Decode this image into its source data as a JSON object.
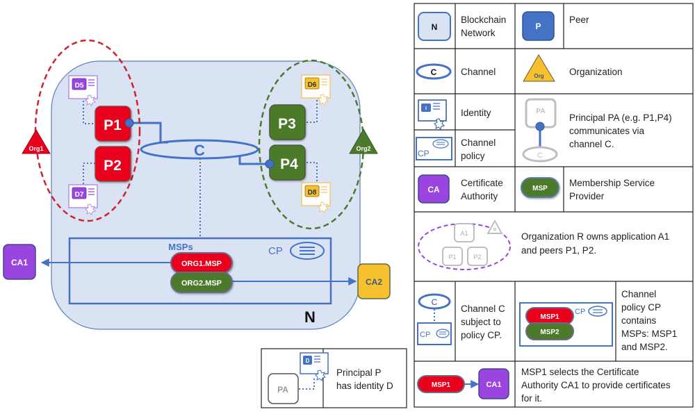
{
  "colors": {
    "network_fill": "#dae3f3",
    "network_stroke": "#2f5597",
    "blue": "#4472c4",
    "red": "#e8001c",
    "green": "#4b7a2c",
    "purple": "#9b45e0",
    "yellow": "#f6c02f",
    "gray": "#a6a6a6"
  },
  "diagram": {
    "network_label": "N",
    "channel_label": "C",
    "org1_label": "Org1",
    "org2_label": "Org2",
    "peers": [
      "P1",
      "P2",
      "P3",
      "P4"
    ],
    "identities": [
      "D5",
      "D6",
      "D7",
      "D8"
    ],
    "msps_title": "MSPs",
    "cp_label": "CP",
    "msp_items": [
      "ORG1.MSP",
      "ORG2.MSP"
    ],
    "ca1": "CA1",
    "ca2": "CA2"
  },
  "identity_legend": {
    "pa_label": "PA",
    "d_label": "D",
    "text_lines": [
      "Principal P",
      "has identity D"
    ]
  },
  "legend": {
    "network": {
      "icon": "N",
      "lines": [
        "Blockchain",
        "Network"
      ]
    },
    "peer": {
      "icon": "P",
      "lines": [
        "Peer"
      ]
    },
    "channel": {
      "icon": "C",
      "lines": [
        "Channel"
      ]
    },
    "organization": {
      "icon": "Org",
      "lines": [
        "Organization"
      ]
    },
    "identity": {
      "icon": "I",
      "lines": [
        "Identity"
      ]
    },
    "channel_policy": {
      "icon": "CP",
      "lines": [
        "Channel",
        "policy"
      ]
    },
    "principal": {
      "icon_pa": "PA",
      "icon_c": "C",
      "lines": [
        "Principal PA (e.g. P1,P4)",
        "communicates via",
        "channel C."
      ]
    },
    "ca": {
      "icon": "CA",
      "lines": [
        "Certificate",
        "Authority"
      ]
    },
    "msp": {
      "icon": "MSP",
      "lines": [
        "Membership Service",
        "Provider"
      ]
    },
    "org_owns": {
      "icons": [
        "A1",
        "P1",
        "P2",
        "R"
      ],
      "lines": [
        "Organization R owns application A1",
        "and peers P1, P2."
      ]
    },
    "channel_subject": {
      "icon_c": "C",
      "icon_cp": "CP",
      "lines": [
        "Channel C",
        "subject to",
        "policy CP."
      ]
    },
    "cp_contains": {
      "icon_cp": "CP",
      "msps": [
        "MSP1",
        "MSP2"
      ],
      "lines": [
        "Channel",
        "policy CP",
        "contains",
        "MSPs: MSP1",
        "and MSP2."
      ]
    },
    "msp_selects": {
      "msp": "MSP1",
      "ca": "CA1",
      "lines": [
        "MSP1 selects the Certificate",
        "Authority CA1 to provide certificates",
        "for it."
      ]
    }
  }
}
